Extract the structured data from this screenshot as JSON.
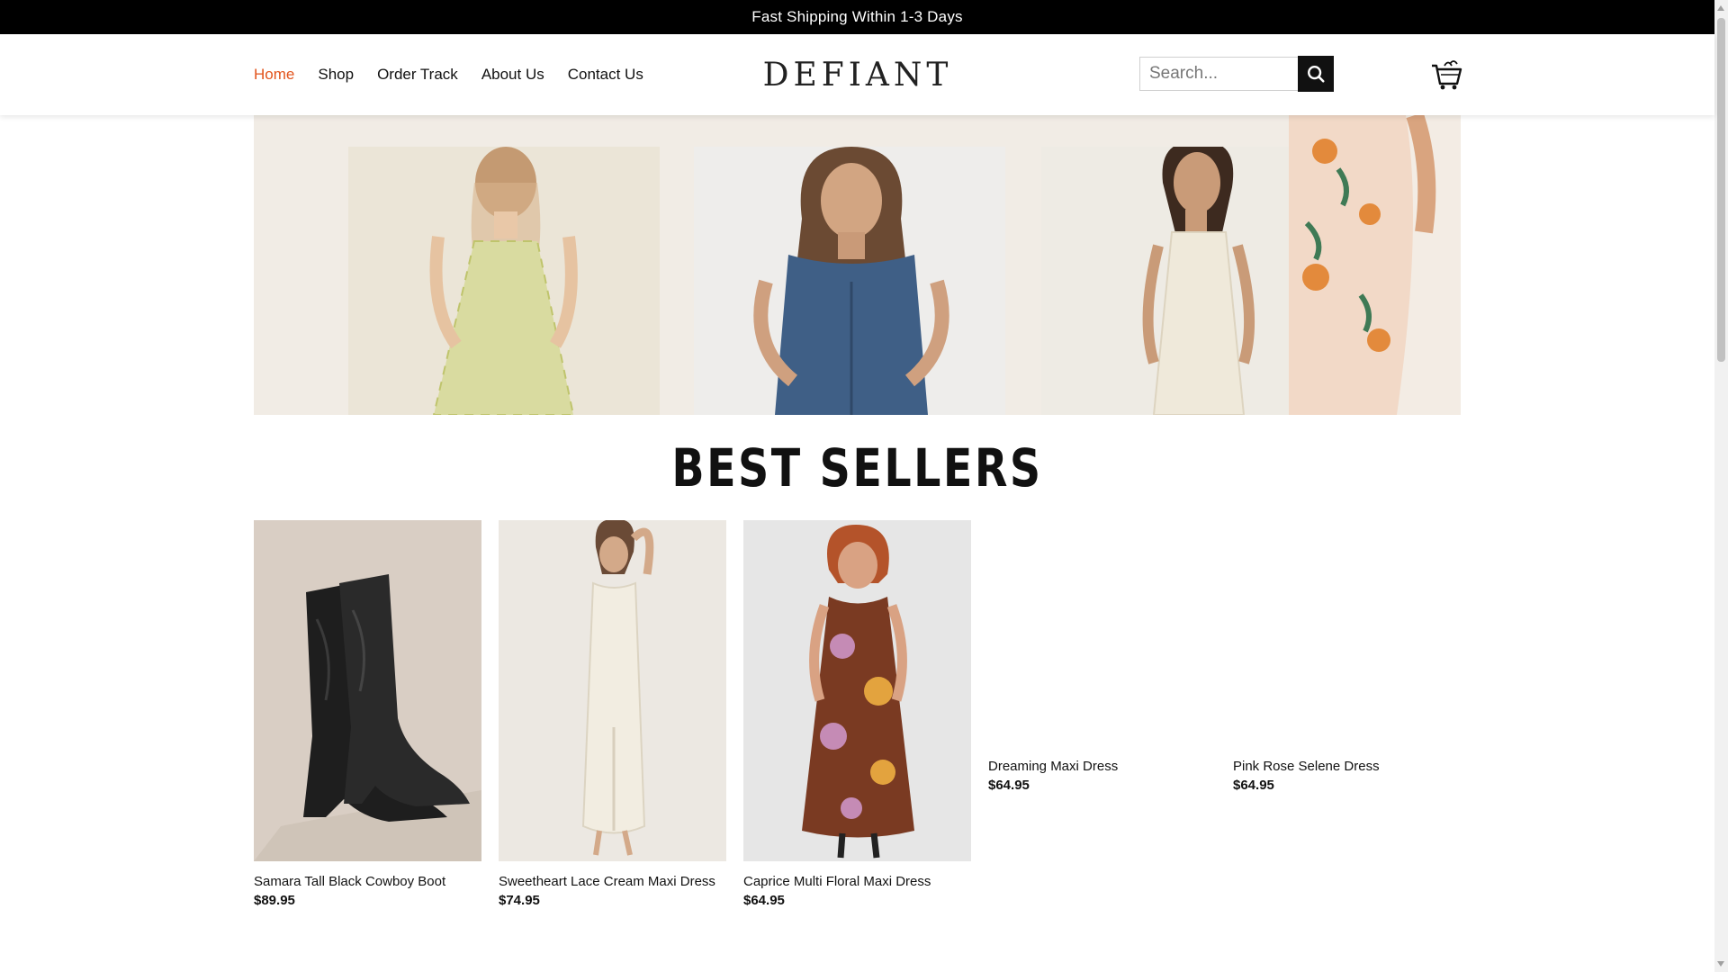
{
  "announcement": "Fast Shipping Within 1-3 Days",
  "nav": {
    "items": [
      {
        "label": "Home",
        "active": true
      },
      {
        "label": "Shop"
      },
      {
        "label": "Order Track"
      },
      {
        "label": "About Us"
      },
      {
        "label": "Contact Us"
      }
    ]
  },
  "brand": {
    "logo": "DEFIANT"
  },
  "search": {
    "placeholder": "Search...",
    "icon": "search-icon"
  },
  "cart": {
    "icon": "cart-icon"
  },
  "colors": {
    "accent": "#e2541c",
    "announcement_bg": "#000000"
  },
  "best_sellers": {
    "title": "BEST SELLERS",
    "products": [
      {
        "name": "Samara Tall Black Cowboy Boot",
        "price": "$89.95"
      },
      {
        "name": "Sweetheart Lace Cream Maxi Dress",
        "price": "$74.95"
      },
      {
        "name": "Caprice Multi Floral Maxi Dress",
        "price": "$64.95"
      },
      {
        "name": "Dreaming Maxi Dress",
        "price": "$64.95"
      },
      {
        "name": "Pink Rose Selene Dress",
        "price": "$64.95"
      }
    ]
  }
}
